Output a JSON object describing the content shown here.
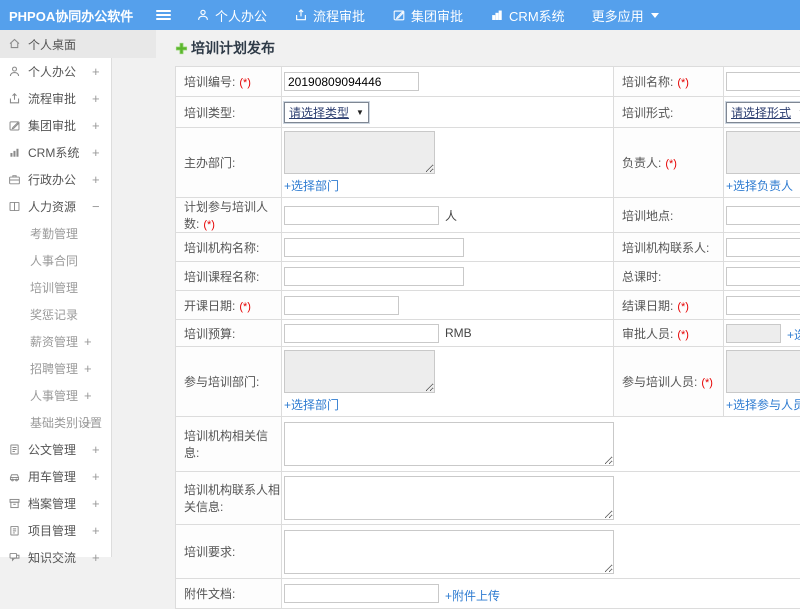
{
  "app": {
    "title": "PHPOA协同办公软件"
  },
  "topnav": {
    "items": [
      {
        "label": "个人办公",
        "icon": "user-icon"
      },
      {
        "label": "流程审批",
        "icon": "workflow-icon"
      },
      {
        "label": "集团审批",
        "icon": "edit-icon"
      },
      {
        "label": "CRM系统",
        "icon": "chart-icon"
      }
    ],
    "more_label": "更多应用"
  },
  "sidebar": {
    "items": [
      {
        "label": "个人桌面",
        "expand": "",
        "icon": "home-icon"
      },
      {
        "label": "个人办公",
        "expand": "+",
        "icon": "user-icon"
      },
      {
        "label": "流程审批",
        "expand": "+",
        "icon": "workflow-icon"
      },
      {
        "label": "集团审批",
        "expand": "+",
        "icon": "edit-icon"
      },
      {
        "label": "CRM系统",
        "expand": "+",
        "icon": "chart-icon"
      },
      {
        "label": "行政办公",
        "expand": "+",
        "icon": "briefcase-icon"
      },
      {
        "label": "人力资源",
        "expand": "−",
        "icon": "book-icon"
      },
      {
        "label": "公文管理",
        "expand": "+",
        "icon": "doc-icon"
      },
      {
        "label": "用车管理",
        "expand": "+",
        "icon": "car-icon"
      },
      {
        "label": "档案管理",
        "expand": "+",
        "icon": "archive-icon"
      },
      {
        "label": "项目管理",
        "expand": "+",
        "icon": "clipboard-icon"
      },
      {
        "label": "知识交流",
        "expand": "+",
        "icon": "chat-icon"
      }
    ],
    "hr_children": [
      {
        "label": "考勤管理",
        "expand": ""
      },
      {
        "label": "人事合同",
        "expand": ""
      },
      {
        "label": "培训管理",
        "expand": ""
      },
      {
        "label": "奖惩记录",
        "expand": ""
      },
      {
        "label": "薪资管理",
        "expand": "+"
      },
      {
        "label": "招聘管理",
        "expand": "+"
      },
      {
        "label": "人事管理",
        "expand": "+"
      },
      {
        "label": "基础类别设置",
        "expand": "+"
      }
    ]
  },
  "page": {
    "title": "培训计划发布"
  },
  "form": {
    "fields": {
      "training_no": {
        "label": "培训编号:",
        "req": "(*)",
        "value": "20190809094446"
      },
      "training_name": {
        "label": "培训名称:",
        "req": "(*)"
      },
      "training_type": {
        "label": "培训类型:",
        "select": "请选择类型"
      },
      "training_form": {
        "label": "培训形式:",
        "select": "请选择形式"
      },
      "host_dept": {
        "label": "主办部门:",
        "link": "+选择部门"
      },
      "leader": {
        "label": "负责人:",
        "req": "(*)",
        "link": "+选择负责人"
      },
      "planned_count": {
        "label": "计划参与培训人数:",
        "req": "(*)",
        "suffix": "人"
      },
      "location": {
        "label": "培训地点:"
      },
      "org_name": {
        "label": "培训机构名称:"
      },
      "org_contact": {
        "label": "培训机构联系人:"
      },
      "course_name": {
        "label": "培训课程名称:"
      },
      "total_hours": {
        "label": "总课时:"
      },
      "start_date": {
        "label": "开课日期:",
        "req": "(*)"
      },
      "end_date": {
        "label": "结课日期:",
        "req": "(*)"
      },
      "budget": {
        "label": "培训预算:",
        "suffix": "RMB"
      },
      "approver": {
        "label": "审批人员:",
        "req": "(*)",
        "link": "+选择审批人员"
      },
      "join_dept": {
        "label": "参与培训部门:",
        "link": "+选择部门"
      },
      "join_people": {
        "label": "参与培训人员:",
        "req": "(*)",
        "link": "+选择参与人员"
      },
      "org_info": {
        "label": "培训机构相关信息:"
      },
      "org_contact_info": {
        "label": "培训机构联系人相关信息:"
      },
      "requirements": {
        "label": "培训要求:"
      },
      "attachment": {
        "label": "附件文档:",
        "link": "+附件上传"
      }
    }
  },
  "colors": {
    "topbar_blue": "#55a0ec",
    "link_blue": "#2f7cd1",
    "required_red": "#e60000",
    "plus_green": "#5ab52d",
    "active_bg": "#e8e8e8",
    "page_bg": "#f1f1f1",
    "cell_border": "#dcdcdc"
  }
}
